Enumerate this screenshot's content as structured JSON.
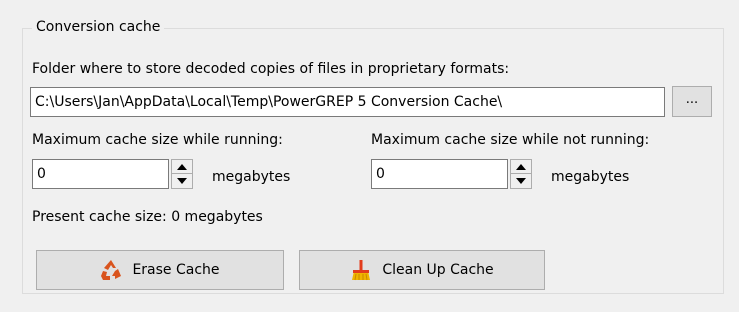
{
  "group": {
    "title": "Conversion cache"
  },
  "folder": {
    "label": "Folder where to store decoded copies of files in proprietary formats:",
    "value": "C:\\Users\\Jan\\AppData\\Local\\Temp\\PowerGREP 5 Conversion Cache\\",
    "browse_label": "..."
  },
  "running": {
    "label": "Maximum cache size while running:",
    "value": "0",
    "unit": "megabytes"
  },
  "not_running": {
    "label": "Maximum cache size while not running:",
    "value": "0",
    "unit": "megabytes"
  },
  "present": {
    "text": "Present cache size: 0 megabytes"
  },
  "buttons": {
    "erase_label": "Erase Cache",
    "erase_icon": "recycle-icon",
    "cleanup_label": "Clean Up Cache",
    "cleanup_icon": "broom-icon"
  },
  "colors": {
    "recycle": "#d9541e",
    "broom_handle": "#e23c1c",
    "broom_bristles": "#f0b400"
  }
}
